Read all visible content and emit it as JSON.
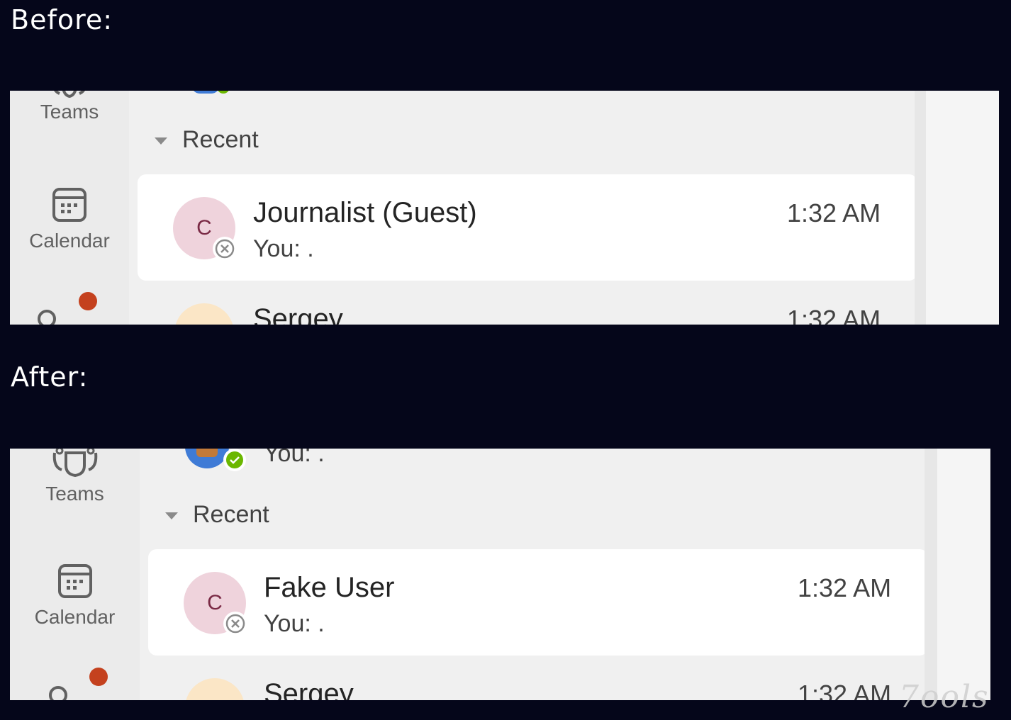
{
  "captions": {
    "before": "Before:",
    "after": "After:"
  },
  "rail": {
    "teams_label": "Teams",
    "calendar_label": "Calendar"
  },
  "before": {
    "section": "Recent",
    "chat": {
      "avatar_initial": "C",
      "name": "Journalist (Guest)",
      "preview": "You: .",
      "time": "1:32 AM"
    },
    "next_chat": {
      "name": "Sergey",
      "time": "1:32 AM"
    }
  },
  "after": {
    "prev_chat_preview": "You: .",
    "section": "Recent",
    "chat": {
      "avatar_initial": "C",
      "name": "Fake User",
      "preview": "You: .",
      "time": "1:32 AM"
    },
    "next_chat": {
      "name": "Sergey",
      "time": "1:32 AM"
    }
  },
  "watermark": "7ools",
  "colors": {
    "page_bg": "#05061a",
    "notify_dot": "#c4411e",
    "avatar_bg": "#efd3dc",
    "available_green": "#6bb700"
  },
  "icons": [
    "teams-icon",
    "calendar-icon",
    "search-icon",
    "caret-down-icon",
    "blocked-status-icon",
    "available-status-icon"
  ]
}
